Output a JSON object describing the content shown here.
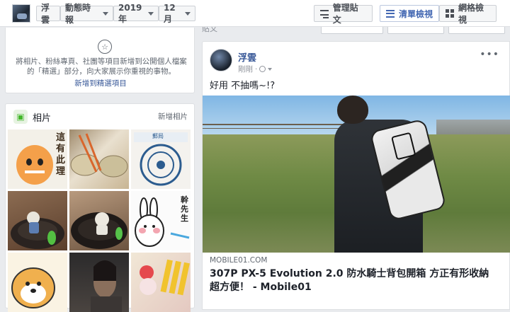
{
  "header": {
    "profile_name": "浮雲",
    "filters": {
      "activity": "動態時報",
      "year": "2019年",
      "month": "12月"
    },
    "buttons": {
      "manage": "管理貼文",
      "list_view": "清單檢視",
      "grid_view": "網格檢視"
    }
  },
  "ghost_toolbar": {
    "posts_label": "貼文",
    "manage": "管理貼文",
    "list_view": "清單檢視",
    "grid_view": "網格檢視"
  },
  "featured": {
    "description": "將相片、粉絲專頁、社團等項目新增到公開個人檔案的「精選」部分，向大家展示你重視的事物。",
    "add_link": "新增到精選項目"
  },
  "photos": {
    "title": "相片",
    "add_label": "新增相片",
    "thumbnails": [
      {
        "text": "這有此理"
      },
      {
        "text": ""
      },
      {
        "text": "郵局"
      },
      {
        "text": ""
      },
      {
        "text": ""
      },
      {
        "text": "幹先生"
      },
      {
        "text": ""
      },
      {
        "text": ""
      },
      {
        "text": ""
      }
    ]
  },
  "post": {
    "author": "浮雲",
    "timestamp": "剛剛",
    "text": "好用 不抽嗎~!?",
    "link": {
      "domain": "MOBILE01.COM",
      "title": "307P PX-5 Evolution 2.0 防水騎士背包開箱 方正有形收納超方便！ - Mobile01"
    },
    "more_icon": "ellipsis-icon"
  },
  "icons": {
    "featured": "star-icon",
    "photos": "photo-icon",
    "privacy": "globe-icon"
  },
  "colors": {
    "link": "#385898",
    "accent": "#4267b2",
    "background": "#e9ebee"
  }
}
